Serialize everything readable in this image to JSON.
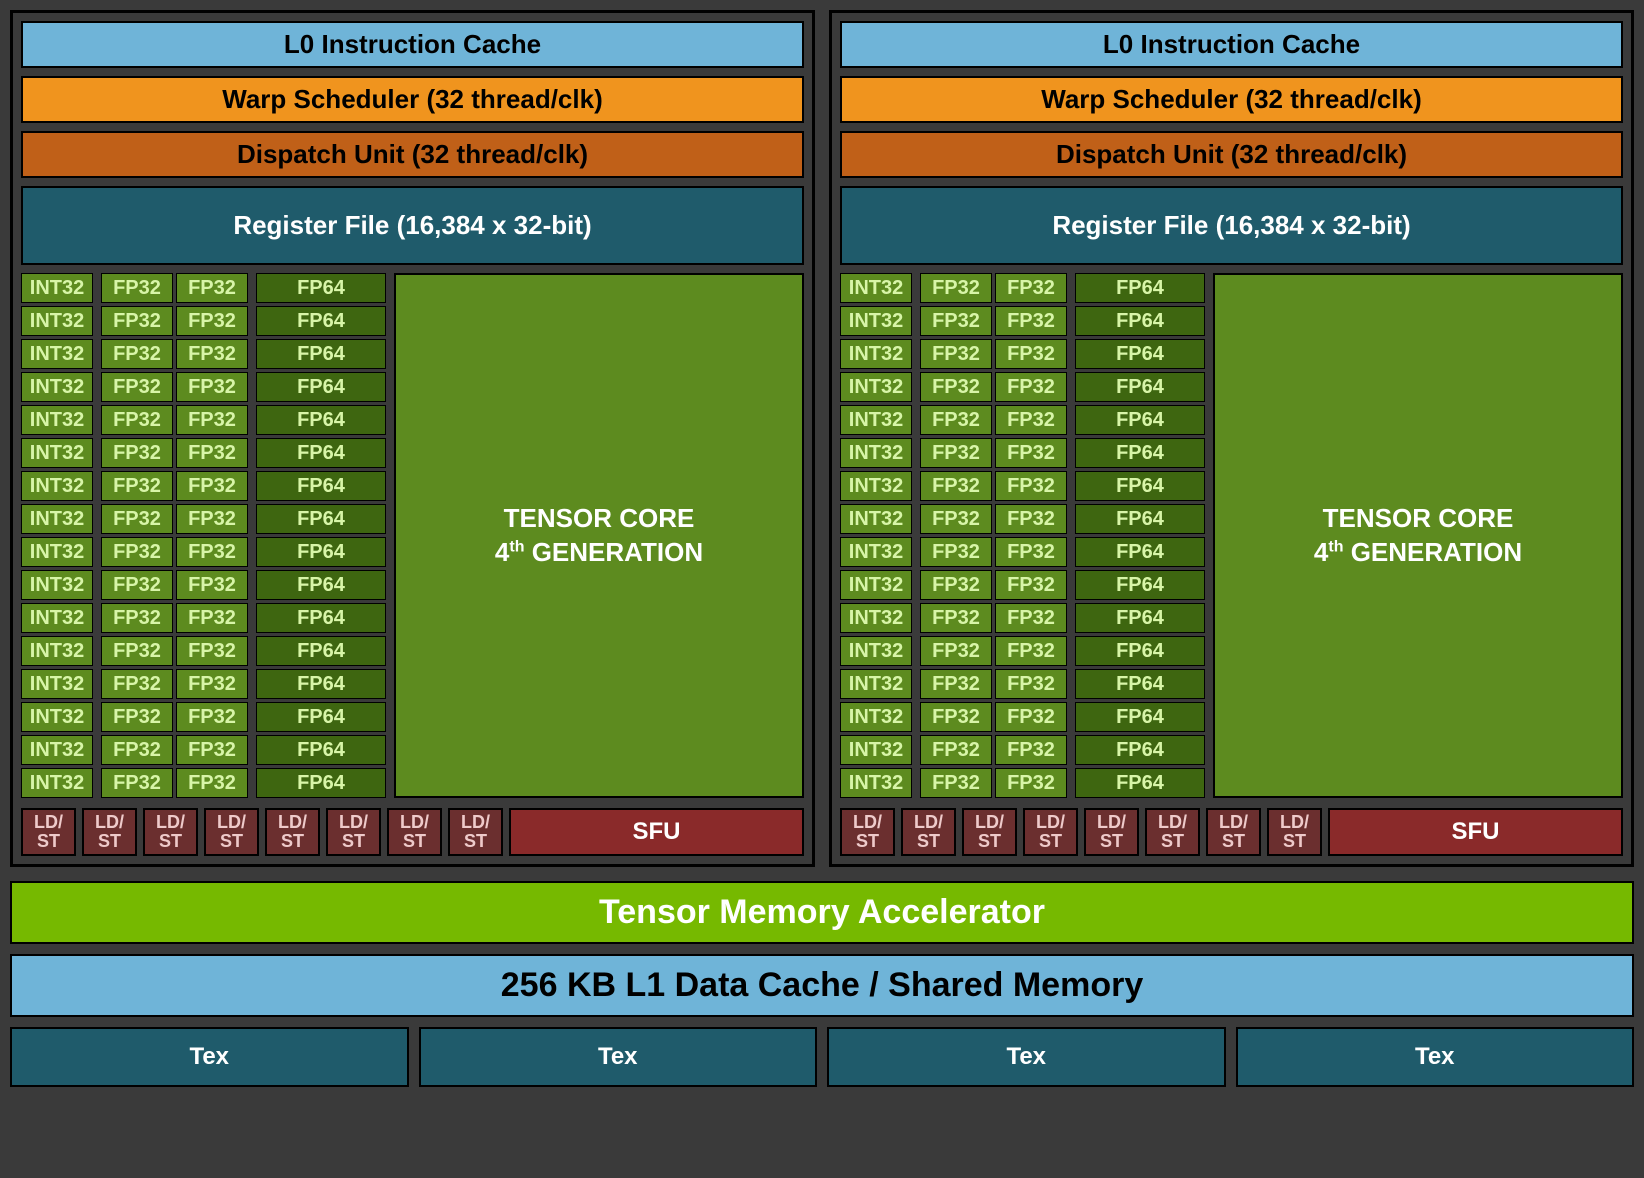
{
  "labels": {
    "l0_cache": "L0 Instruction Cache",
    "warp_scheduler": "Warp Scheduler (32 thread/clk)",
    "dispatch_unit": "Dispatch Unit (32 thread/clk)",
    "register_file": "Register File (16,384 x 32-bit)",
    "int32": "INT32",
    "fp32": "FP32",
    "fp64": "FP64",
    "tensor_core_line1": "TENSOR CORE",
    "tensor_core_line2a": "4",
    "tensor_core_line2sup": "th",
    "tensor_core_line2b": " GENERATION",
    "ldst_line1": "LD/",
    "ldst_line2": "ST",
    "sfu": "SFU",
    "tma": "Tensor Memory Accelerator",
    "l1_cache": "256 KB L1 Data Cache / Shared Memory",
    "tex": "Tex"
  },
  "counts": {
    "partitions": 2,
    "int32_rows": 16,
    "fp32_rows": 16,
    "fp64_rows": 16,
    "ldst_units": 8,
    "tex_units": 4
  },
  "colors": {
    "background": "#3a3a3a",
    "l0_cache": "#6fb4d8",
    "warp_scheduler": "#f0941e",
    "dispatch_unit": "#c06018",
    "register_file": "#1f5b6b",
    "compute_green": "#5d8b1f",
    "fp64_green": "#3e6610",
    "ldst_maroon": "#6b2f2f",
    "sfu_maroon": "#8a2a2a",
    "tma_green": "#76b900"
  }
}
